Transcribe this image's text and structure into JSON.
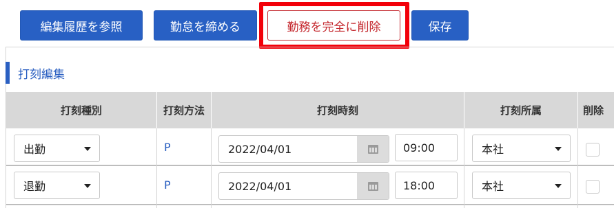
{
  "toolbar": {
    "history_label": "編集履歴を参照",
    "close_label": "勤怠を締める",
    "delete_label": "勤務を完全に削除",
    "save_label": "保存"
  },
  "section": {
    "title": "打刻編集"
  },
  "table": {
    "headers": {
      "type": "打刻種別",
      "method": "打刻方法",
      "datetime": "打刻時刻",
      "affiliation": "打刻所属",
      "delete": "削除"
    },
    "rows": [
      {
        "type": "出勤",
        "method": "P",
        "date": "2022/04/01",
        "time": "09:00",
        "affiliation": "本社",
        "delete_checked": false
      },
      {
        "type": "退勤",
        "method": "P",
        "date": "2022/04/01",
        "time": "18:00",
        "affiliation": "本社",
        "delete_checked": false
      }
    ]
  },
  "colors": {
    "primary": "#2860c4",
    "danger": "#c4272d",
    "highlight": "#f2000a",
    "header_bg": "#d8d8d8"
  },
  "icons": {
    "date_picker": "calendar-icon",
    "dropdown": "chevron-down-icon"
  }
}
